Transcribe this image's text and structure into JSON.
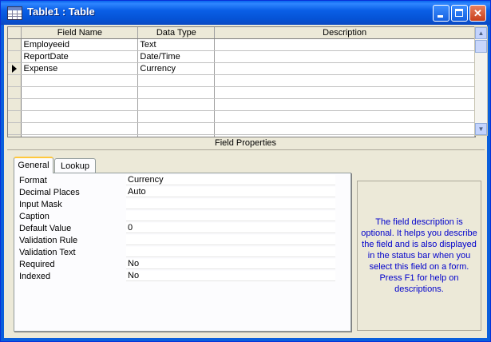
{
  "window": {
    "title": "Table1 : Table"
  },
  "grid": {
    "columns": [
      "Field Name",
      "Data Type",
      "Description"
    ],
    "rows": [
      {
        "field_name": "Employeeid",
        "data_type": "Text",
        "description": ""
      },
      {
        "field_name": "ReportDate",
        "data_type": "Date/Time",
        "description": ""
      },
      {
        "field_name": "Expense",
        "data_type": "Currency",
        "description": ""
      }
    ],
    "current_row": 3
  },
  "field_properties": {
    "title": "Field Properties",
    "tabs": [
      "General",
      "Lookup"
    ],
    "active_tab": "General",
    "properties": [
      {
        "label": "Format",
        "value": "Currency"
      },
      {
        "label": "Decimal Places",
        "value": "Auto"
      },
      {
        "label": "Input Mask",
        "value": ""
      },
      {
        "label": "Caption",
        "value": ""
      },
      {
        "label": "Default Value",
        "value": "0"
      },
      {
        "label": "Validation Rule",
        "value": ""
      },
      {
        "label": "Validation Text",
        "value": ""
      },
      {
        "label": "Required",
        "value": "No"
      },
      {
        "label": "Indexed",
        "value": "No"
      }
    ],
    "help_text": "The field description is optional.  It helps you describe the field and is also displayed in the status bar when you select this field on a form.  Press F1 for help on descriptions."
  },
  "icons": {
    "app": "table-icon",
    "minimize": "minimize-icon",
    "maximize": "maximize-icon",
    "close": "close-icon",
    "row_selector": "current-row-arrow-icon"
  },
  "colors": {
    "titlebar": "#0a5fe6",
    "help_text": "#0000cc",
    "window_bg": "#ece9d8"
  }
}
